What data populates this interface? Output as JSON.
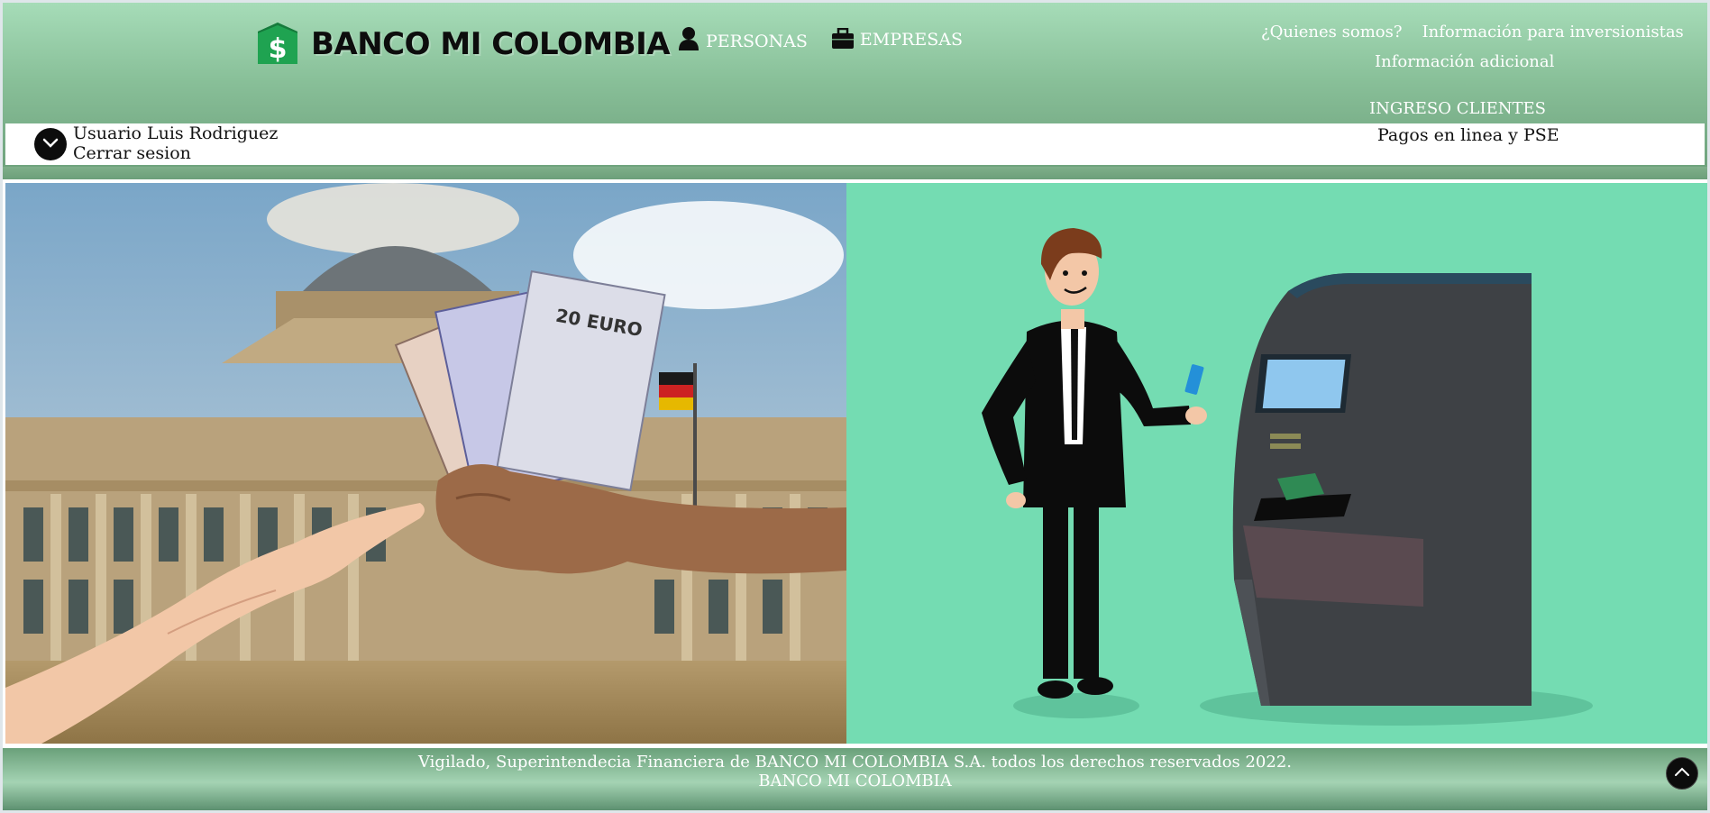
{
  "header": {
    "brand": "BANCO MI COLOMBIA",
    "logo_symbol": "$",
    "nav": [
      {
        "label": "PERSONAS",
        "icon": "person-icon"
      },
      {
        "label": "EMPRESAS",
        "icon": "briefcase-icon"
      }
    ],
    "links": [
      "¿Quienes somos?",
      "Información para inversionistas",
      "Información adicional"
    ],
    "ingreso": "INGRESO CLIENTES"
  },
  "userbar": {
    "user_label": "Usuario Luis Rodriguez",
    "logout_label": "Cerrar sesion",
    "pagos_label": "Pagos en linea y PSE"
  },
  "hero": {
    "left_image": "hands-money-building-photo",
    "right_image": "man-atm-illustration",
    "banknote_text": "20 EURO"
  },
  "footer": {
    "line1": "Vigilado, Superintendecia Financiera de BANCO MI COLOMBIA S.A. todos los derechos reservados 2022.",
    "line2": "BANCO MI COLOMBIA"
  },
  "colors": {
    "header_green": "#88bf98",
    "illustration_bg": "#74dcb2",
    "logo_green": "#1fa351"
  }
}
